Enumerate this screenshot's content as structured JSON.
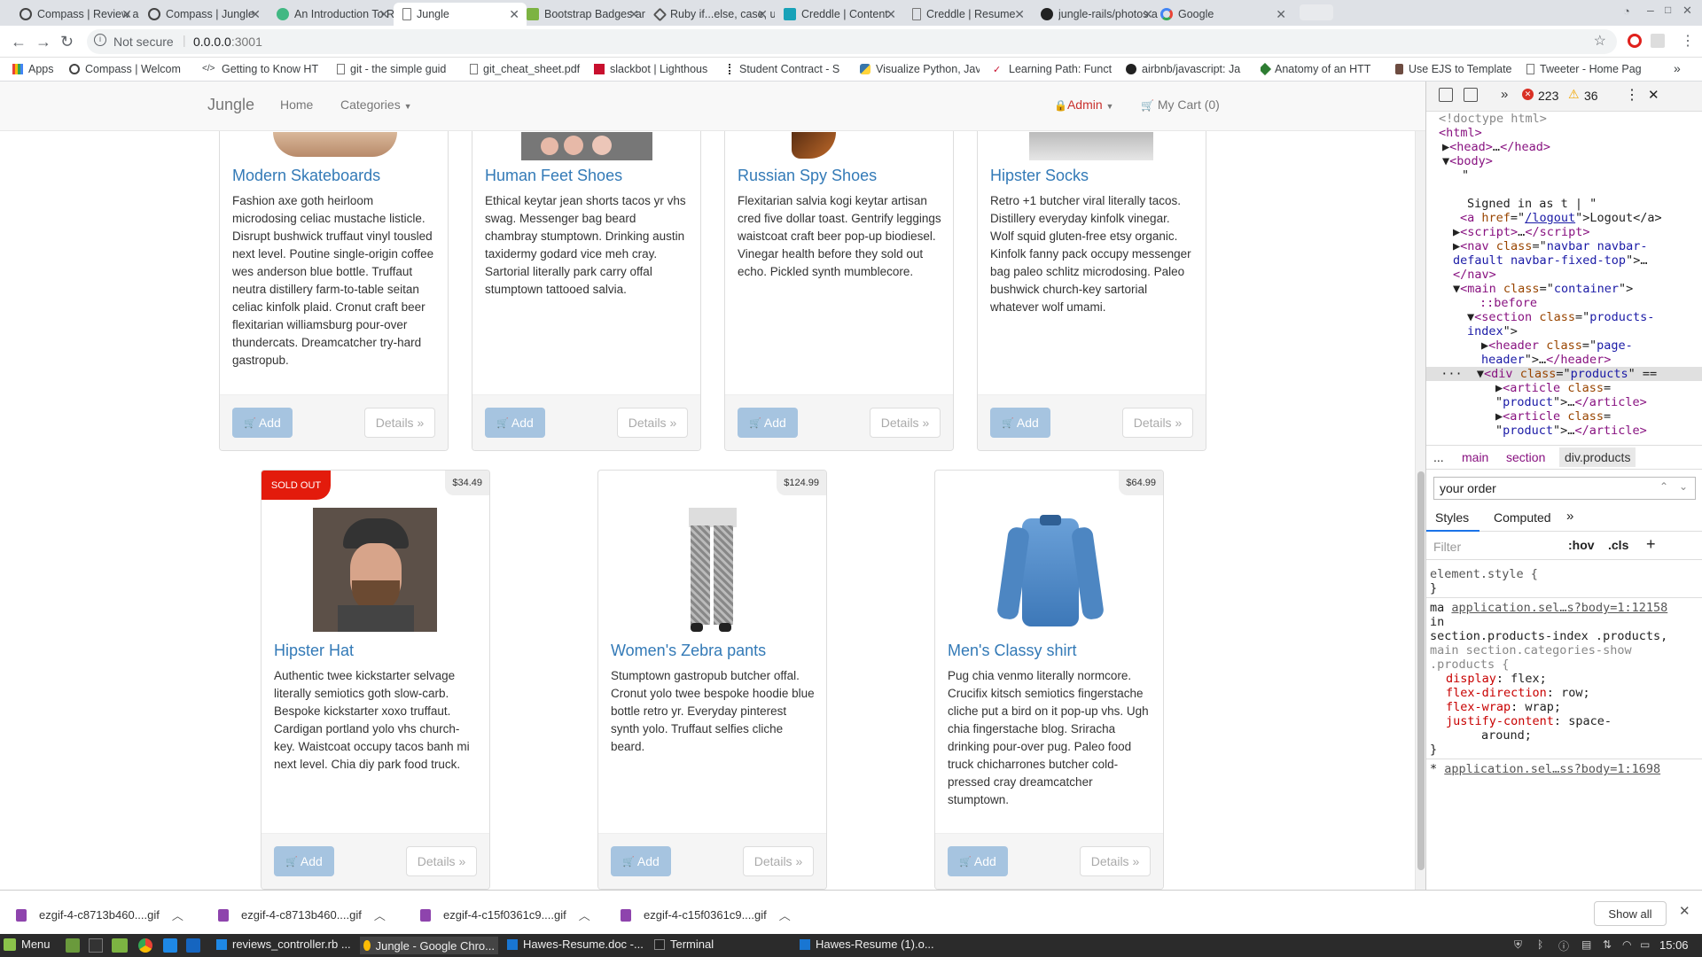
{
  "tabs": [
    {
      "title": "Compass | Review a",
      "active": false
    },
    {
      "title": "Compass | Jungle",
      "active": false
    },
    {
      "title": "An Introduction To R",
      "active": false
    },
    {
      "title": "Jungle",
      "active": true
    },
    {
      "title": "Bootstrap Badges ar",
      "active": false
    },
    {
      "title": "Ruby if...else, case, u",
      "active": false
    },
    {
      "title": "Creddle | Content",
      "active": false
    },
    {
      "title": "Creddle | Resume",
      "active": false
    },
    {
      "title": "jungle-rails/photos a",
      "active": false
    },
    {
      "title": "Google",
      "active": false
    }
  ],
  "toolbar": {
    "security": "Not secure",
    "url_host": "0.0.0.0",
    "url_port": ":3001"
  },
  "bookmarks": [
    "Apps",
    "Compass | Welcom",
    "Getting to Know HT",
    "git - the simple guid",
    "git_cheat_sheet.pdf",
    "slackbot | Lighthous",
    "Student Contract - S",
    "Visualize Python, Jav",
    "Learning Path: Funct",
    "airbnb/javascript: Ja",
    "Anatomy of an HTT",
    "Use EJS to Template",
    "Tweeter - Home Pag"
  ],
  "navbar": {
    "brand": "Jungle",
    "home": "Home",
    "categories": "Categories",
    "admin": "Admin",
    "cart": "My Cart (0)"
  },
  "products_top": [
    {
      "name": "Modern Skateboards",
      "description": "Fashion axe goth heirloom microdosing celiac mustache listicle. Disrupt bushwick truffaut vinyl tousled next level. Poutine single-origin coffee wes anderson blue bottle. Truffaut neutra distillery farm-to-table seitan celiac kinfolk plaid. Cronut craft beer flexitarian williamsburg pour-over thundercats. Dreamcatcher try-hard gastropub."
    },
    {
      "name": "Human Feet Shoes",
      "description": "Ethical keytar jean shorts tacos yr vhs swag. Messenger bag beard chambray stumptown. Drinking austin taxidermy godard vice meh cray. Sartorial literally park carry offal stumptown tattooed salvia."
    },
    {
      "name": "Russian Spy Shoes",
      "description": "Flexitarian salvia kogi keytar artisan cred five dollar toast. Gentrify leggings waistcoat craft beer pop-up biodiesel. Vinegar health before they sold out echo. Pickled synth mumblecore."
    },
    {
      "name": "Hipster Socks",
      "description": "Retro +1 butcher viral literally tacos. Distillery everyday kinfolk vinegar. Wolf squid gluten-free etsy organic. Kinfolk fanny pack occupy messenger bag paleo schlitz microdosing. Paleo bushwick church-key sartorial whatever wolf umami."
    }
  ],
  "products_bottom": [
    {
      "name": "Hipster Hat",
      "price": "$34.49",
      "sold_out": "SOLD OUT",
      "description": "Authentic twee kickstarter selvage literally semiotics goth slow-carb. Bespoke kickstarter xoxo truffaut. Cardigan portland yolo vhs church-key. Waistcoat occupy tacos banh mi next level. Chia diy park food truck."
    },
    {
      "name": "Women's Zebra pants",
      "price": "$124.99",
      "description": "Stumptown gastropub butcher offal. Cronut yolo twee bespoke hoodie blue bottle retro yr. Everyday pinterest synth yolo. Truffaut selfies cliche beard."
    },
    {
      "name": "Men's Classy shirt",
      "price": "$64.99",
      "description": "Pug chia venmo literally normcore. Crucifix kitsch semiotics fingerstache cliche put a bird on it pop-up vhs. Ugh chia fingerstache blog. Sriracha drinking pour-over pug. Paleo food truck chicharrones butcher cold-pressed cray dreamcatcher stumptown."
    }
  ],
  "buttons": {
    "add": "Add",
    "details": "Details »"
  },
  "devtools": {
    "errors": "223",
    "warnings": "36",
    "breadcrumbs": [
      "...",
      "main",
      "section",
      "div.products"
    ],
    "search_value": "your order",
    "tab_styles": "Styles",
    "tab_computed": "Computed",
    "filter_placeholder": "Filter",
    "hov": ":hov",
    "cls": ".cls",
    "element_style": "element.style {",
    "close_brace": "}",
    "rule_prefix": "ma",
    "rule_link": "application.sel…s?body=1:12158",
    "rule_in": "in",
    "rule_selector": "section.products-index .products,",
    "rule_selector2": "main section.categories-show",
    "rule_selector3": ".products {",
    "props": [
      {
        "name": "display",
        "value": "flex;"
      },
      {
        "name": "flex-direction",
        "value": "row;"
      },
      {
        "name": "flex-wrap",
        "value": "wrap;"
      },
      {
        "name": "justify-content",
        "value": "space-"
      },
      {
        "name": "",
        "value": "around;"
      }
    ],
    "rule2_link": "application.sel…ss?body=1:1698"
  },
  "downloads": [
    "ezgif-4-c8713b460....gif",
    "ezgif-4-c8713b460....gif",
    "ezgif-4-c15f0361c9....gif",
    "ezgif-4-c15f0361c9....gif"
  ],
  "show_all": "Show all",
  "taskbar": {
    "menu": "Menu",
    "items": [
      "reviews_controller.rb ...",
      "Jungle - Google Chro...",
      "Hawes-Resume.doc -...",
      "Terminal",
      "Hawes-Resume (1).o..."
    ],
    "clock": "15:06"
  }
}
